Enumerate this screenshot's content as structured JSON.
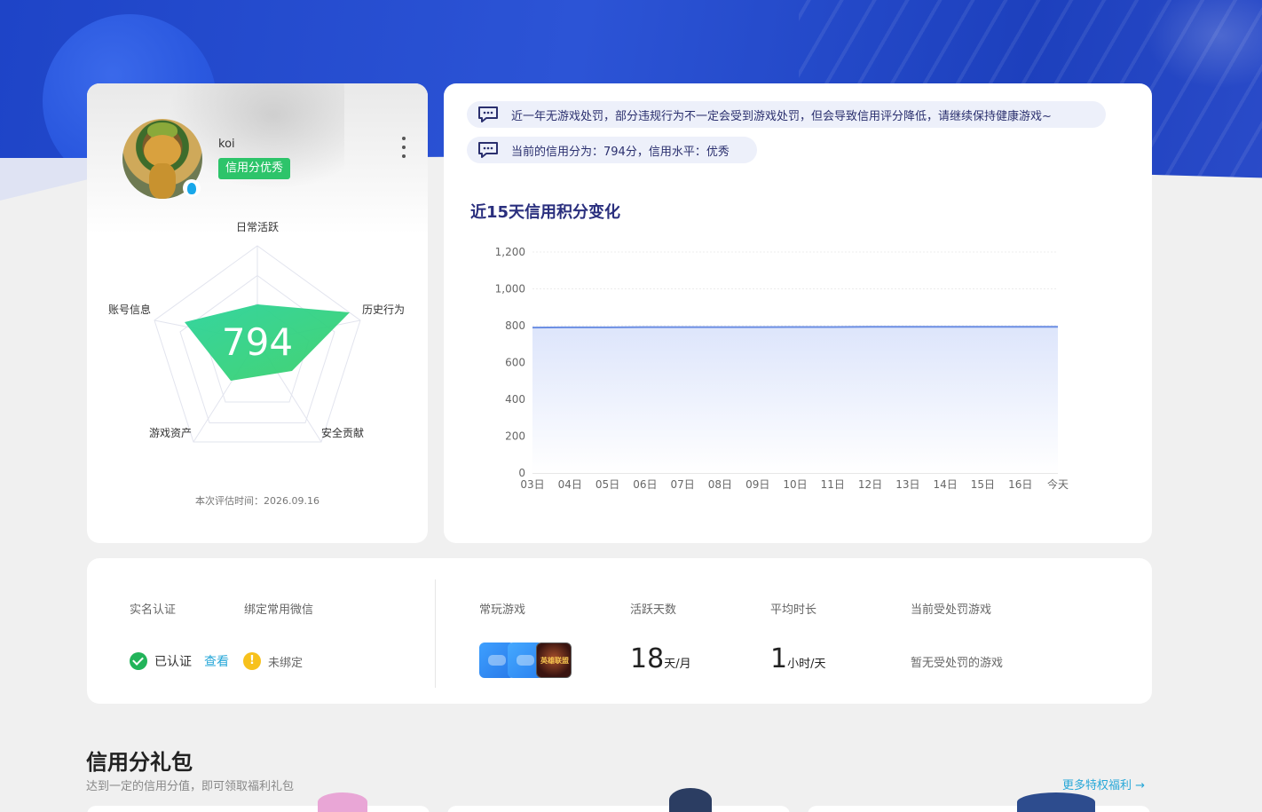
{
  "profile": {
    "username": "koi",
    "credit_tag": "信用分优秀",
    "score": "794",
    "radar_labels": {
      "top": "日常活跃",
      "right": "历史行为",
      "bottom_right": "安全贡献",
      "bottom_left": "游戏资产",
      "left": "账号信息"
    },
    "eval_time": "本次评估时间：2026.09.16",
    "colors": {
      "tag": "#2dc46a",
      "radar_fill_start": "#2bd39a",
      "radar_fill_end": "#3bd06a"
    }
  },
  "notices": {
    "line1": "近一年无游戏处罚，部分违规行为不一定会受到游戏处罚，但会导致信用评分降低，请继续保持健康游戏~",
    "line2": "当前的信用分为：794分，信用水平：优秀"
  },
  "chart_title": "近15天信用积分变化",
  "chart_data": {
    "type": "area",
    "title": "近15天信用积分变化",
    "xlabel": "",
    "ylabel": "",
    "ylim": [
      0,
      1200
    ],
    "yticks": [
      "0",
      "200",
      "400",
      "600",
      "800",
      "1,000",
      "1,200"
    ],
    "categories": [
      "03日",
      "04日",
      "05日",
      "06日",
      "07日",
      "08日",
      "09日",
      "10日",
      "11日",
      "12日",
      "13日",
      "14日",
      "15日",
      "16日",
      "今天"
    ],
    "values": [
      790,
      791,
      791,
      792,
      792,
      792,
      792,
      793,
      793,
      794,
      794,
      794,
      794,
      794,
      794
    ],
    "grid": true,
    "color": "#6b8ee3"
  },
  "stats": {
    "realname_label": "实名认证",
    "wechat_label": "绑定常用微信",
    "verified_text": "已认证",
    "view_link": "查看",
    "unbound_text": "未绑定",
    "games_label": "常玩游戏",
    "game_icon_text": "英雄联盟",
    "active_days_label": "活跃天数",
    "active_days_value": "18",
    "active_days_unit": "天/月",
    "avg_time_label": "平均时长",
    "avg_time_value": "1",
    "avg_time_unit": "小时/天",
    "penalty_label": "当前受处罚游戏",
    "penalty_value": "暂无受处罚的游戏"
  },
  "gift_section": {
    "title": "信用分礼包",
    "subtitle": "达到一定的信用分值，即可领取福利礼包",
    "more_link": "更多特权福利 →"
  }
}
